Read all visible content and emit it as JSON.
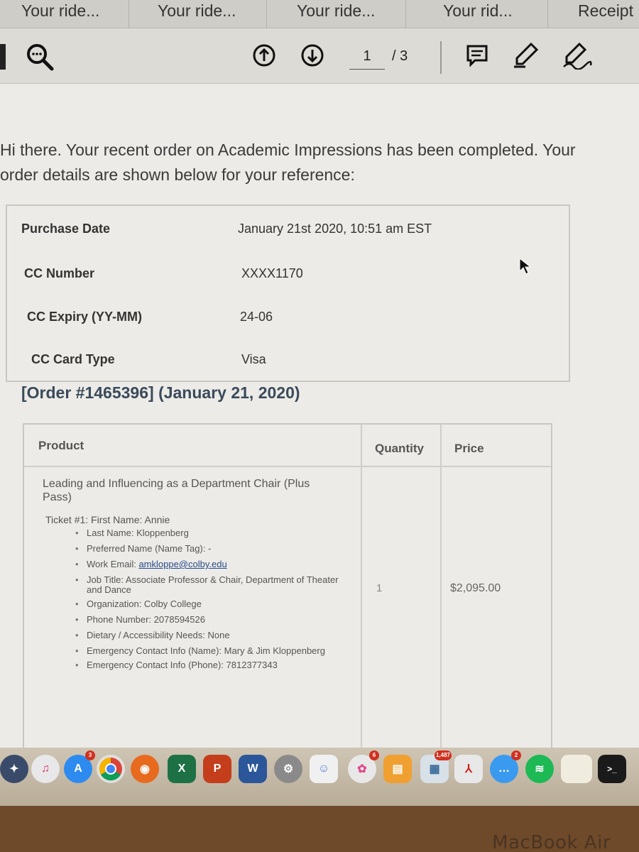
{
  "tabs": [
    "Your ride...",
    "Your ride...",
    "Your ride...",
    "Your rid...",
    "Receipt"
  ],
  "toolbar": {
    "page_current": "1",
    "page_total": "/ 3"
  },
  "intro": "Hi there. Your recent order on Academic Impressions has been completed. Your order details are shown below for your reference:",
  "details": [
    {
      "label": "Purchase Date",
      "value": "January 21st 2020, 10:51 am EST"
    },
    {
      "label": "CC Number",
      "value": "XXXX1170"
    },
    {
      "label": "CC Expiry (YY-MM)",
      "value": "24-06"
    },
    {
      "label": "CC Card Type",
      "value": "Visa"
    }
  ],
  "order_title": "[Order #1465396] (January 21, 2020)",
  "table": {
    "headers": {
      "product": "Product",
      "quantity": "Quantity",
      "price": "Price"
    },
    "product_name": "Leading and Influencing as a Department Chair (Plus Pass)",
    "ticket_head": "Ticket #1: First Name: Annie",
    "items": [
      "Last Name: Kloppenberg",
      "Preferred Name (Name Tag): -",
      "Work Email: ",
      "Job Title: Associate Professor & Chair, Department of Theater and Dance",
      "Organization: Colby College",
      "Phone Number: 2078594526",
      "Dietary / Accessibility Needs: None",
      "Emergency Contact Info (Name): Mary & Jim Kloppenberg",
      "Emergency Contact Info (Phone): 7812377343"
    ],
    "email": "amkloppe@colby.edu",
    "quantity": "1",
    "price": "$2,095.00"
  },
  "dock": {
    "appstore_badge": "3",
    "photos_badge": "6",
    "preview_badge": "1,487",
    "messages_badge": "2"
  },
  "bezel_label": "MacBook Air"
}
